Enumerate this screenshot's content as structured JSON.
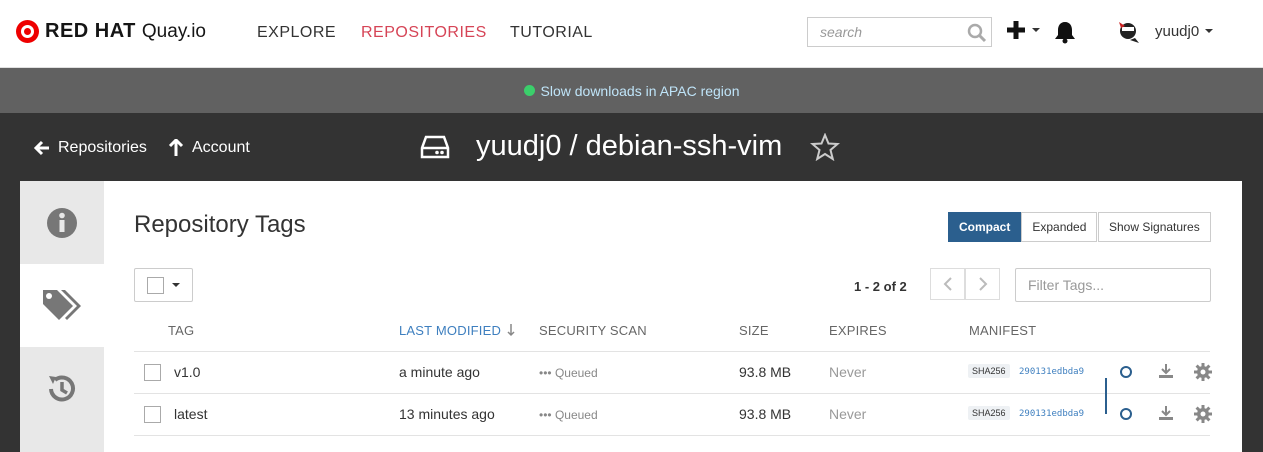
{
  "brand": {
    "name": "RED HAT",
    "product": "Quay.io"
  },
  "nav": {
    "explore": "EXPLORE",
    "repositories": "REPOSITORIES",
    "tutorial": "TUTORIAL"
  },
  "search": {
    "placeholder": "search"
  },
  "user": {
    "name": "yuudj0"
  },
  "announcement": {
    "text": "Slow downloads in APAC region"
  },
  "header": {
    "back_label": "Repositories",
    "account_label": "Account",
    "repo_title": "yuudj0 / debian-ssh-vim"
  },
  "tags": {
    "title": "Repository Tags",
    "view_compact": "Compact",
    "view_expanded": "Expanded",
    "show_signatures": "Show Signatures",
    "paging": "1 - 2 of 2",
    "filter_placeholder": "Filter Tags...",
    "columns": {
      "tag": "TAG",
      "last_modified": "LAST MODIFIED",
      "security_scan": "SECURITY SCAN",
      "size": "SIZE",
      "expires": "EXPIRES",
      "manifest": "MANIFEST"
    },
    "rows": [
      {
        "tag": "v1.0",
        "last_modified": "a minute ago",
        "scan": "Queued",
        "scan_prefix": "•••",
        "size": "93.8 MB",
        "expires": "Never",
        "sha_label": "SHA256",
        "sha": "290131edbda9"
      },
      {
        "tag": "latest",
        "last_modified": "13 minutes ago",
        "scan": "Queued",
        "scan_prefix": "•••",
        "size": "93.8 MB",
        "expires": "Never",
        "sha_label": "SHA256",
        "sha": "290131edbda9"
      }
    ]
  },
  "colors": {
    "accent": "#2b5f8e",
    "active_nav": "#d64456",
    "status_dot": "#3bcf6b",
    "link": "#3e7fbf"
  }
}
